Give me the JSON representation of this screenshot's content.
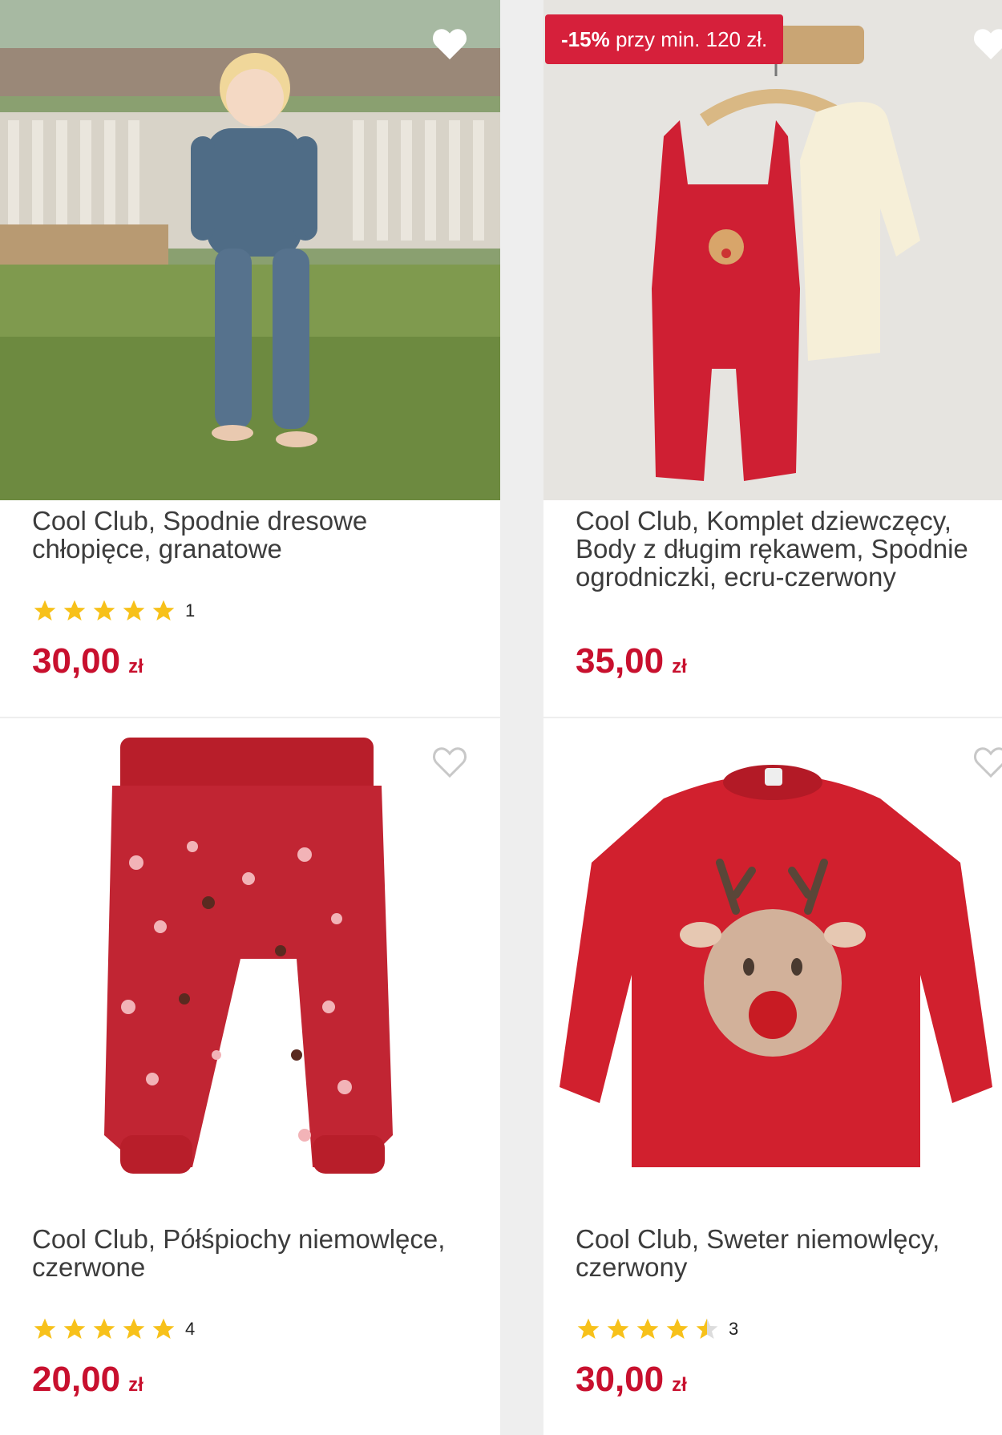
{
  "products": [
    {
      "title": "Cool Club, Spodnie dresowe chłopięce, granatowe",
      "rating_count": "1",
      "rating_stars": 5,
      "price": "30,00",
      "currency": "zł",
      "favorite_icon": "heart-outline-icon"
    },
    {
      "promo_discount": "-15%",
      "promo_text": "przy min. 120 zł.",
      "title": "Cool Club, Komplet dziewczęcy, Body z długim rękawem, Spodnie ogrodniczki, ecru-czerwony",
      "price": "35,00",
      "currency": "zł",
      "favorite_icon": "heart-outline-icon"
    },
    {
      "title": "Cool Club, Półśpiochy niemowlęce, czerwone",
      "rating_count": "4",
      "rating_stars": 5,
      "price": "20,00",
      "currency": "zł",
      "favorite_icon": "heart-outline-icon"
    },
    {
      "title": "Cool Club, Sweter niemowlęcy, czerwony",
      "rating_count": "3",
      "rating_stars": 4.5,
      "price": "30,00",
      "currency": "zł",
      "favorite_icon": "heart-outline-icon"
    }
  ],
  "colors": {
    "price": "#c8102e",
    "promo": "#d6203b",
    "star": "#f7c11a"
  }
}
